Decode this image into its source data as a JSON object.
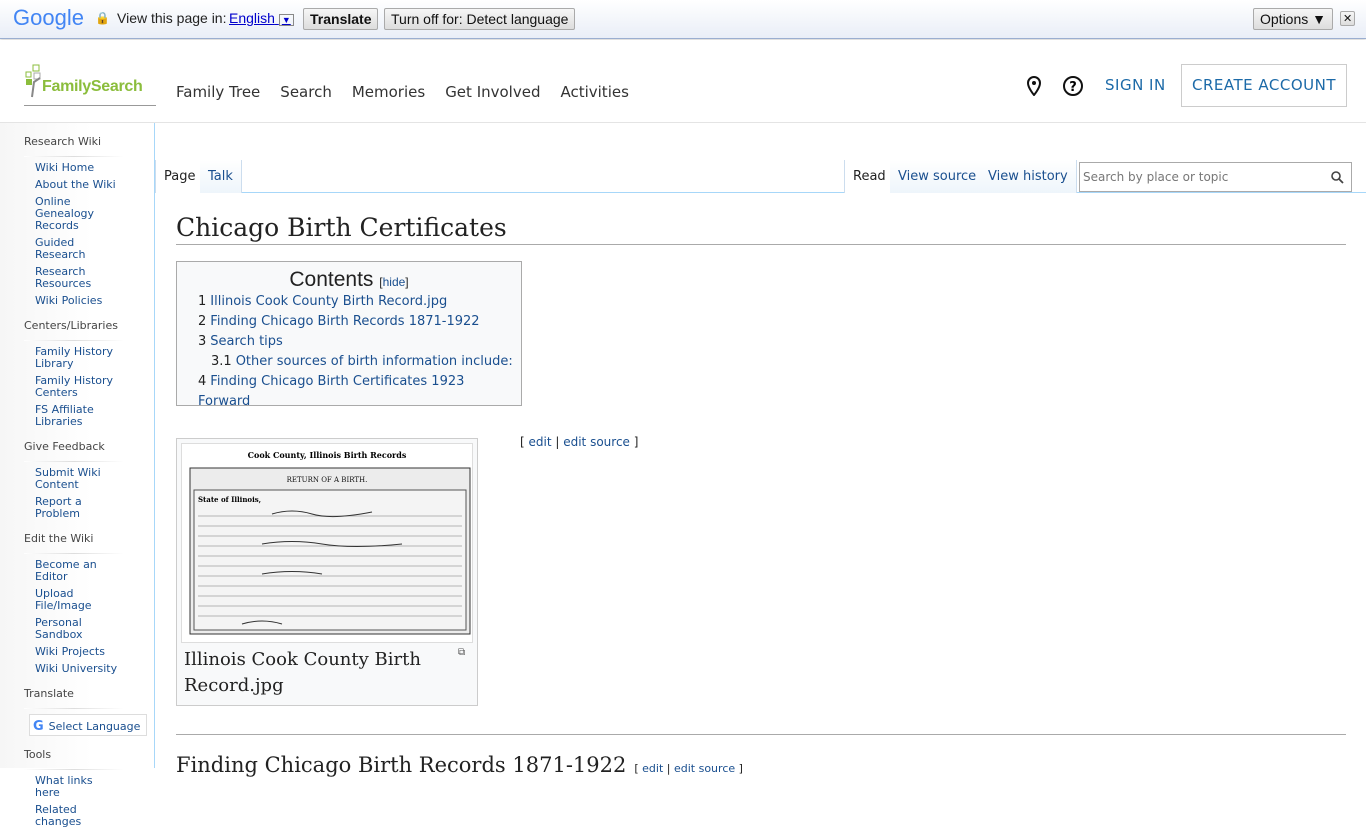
{
  "translate_bar": {
    "brand": "Google",
    "prompt": "View this page in:",
    "language": "English",
    "translate": "Translate",
    "turn_off": "Turn off for: Detect language",
    "options": "Options ▼",
    "close": "✕"
  },
  "header": {
    "logo": "FamilySearch",
    "nav": [
      "Family Tree",
      "Search",
      "Memories",
      "Get Involved",
      "Activities"
    ],
    "sign_in": "SIGN IN",
    "create_account": "CREATE ACCOUNT"
  },
  "sidebar": {
    "sections": [
      {
        "title": "Research Wiki",
        "items": [
          "Wiki Home",
          "About the Wiki",
          "Online Genealogy Records",
          "Guided Research",
          "Research Resources",
          "Wiki Policies"
        ]
      },
      {
        "title": "Centers/Libraries",
        "items": [
          "Family History Library",
          "Family History Centers",
          "FS Affiliate Libraries"
        ]
      },
      {
        "title": "Give Feedback",
        "items": [
          "Submit Wiki Content",
          "Report a Problem"
        ]
      },
      {
        "title": "Edit the Wiki",
        "items": [
          "Become an Editor",
          "Upload File/Image",
          "Personal Sandbox",
          "Wiki Projects",
          "Wiki University"
        ]
      },
      {
        "title": "Translate",
        "items": []
      },
      {
        "title": "Tools",
        "items": [
          "What links here",
          "Related changes"
        ]
      }
    ],
    "select_language": "Select Language"
  },
  "tabs": {
    "page": "Page",
    "talk": "Talk",
    "read": "Read",
    "view_source": "View source",
    "view_history": "View history",
    "search_placeholder": "Search by place or topic"
  },
  "content": {
    "title": "Chicago Birth Certificates",
    "toc": {
      "title": "Contents",
      "hide": "hide",
      "items": [
        {
          "num": "1",
          "label": "Illinois Cook County Birth Record.jpg"
        },
        {
          "num": "2",
          "label": "Finding Chicago Birth Records 1871-1922"
        },
        {
          "num": "3",
          "label": "Search tips"
        },
        {
          "num": "3.1",
          "label": "Other sources of birth information include:"
        },
        {
          "num": "4",
          "label": "Finding Chicago Birth Certificates 1923 Forward"
        }
      ]
    },
    "edit": "edit",
    "edit_source": "edit source",
    "image_caption": "Illinois Cook County Birth Record.jpg",
    "image_text": {
      "heading": "Cook County, Illinois Birth Records",
      "sub": "RETURN OF A BIRTH.",
      "state": "State of Illinois,"
    },
    "section2": "Finding Chicago Birth Records 1871-1922"
  }
}
